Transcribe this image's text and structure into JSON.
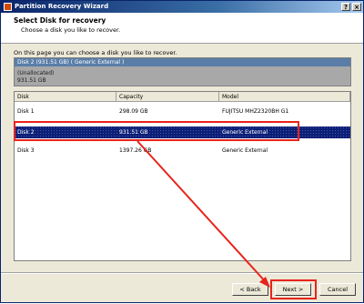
{
  "window": {
    "title": "Partition Recovery Wizard"
  },
  "titlebar_buttons": {
    "help": "?",
    "close": "×"
  },
  "header": {
    "title": "Select Disk for recovery",
    "subtitle": "Choose a disk you like to recover."
  },
  "intro_text": "On this page you can choose a disk you like to recover.",
  "disk_info": {
    "heading": "Disk 2 (931.51 GB) ( Generic External )",
    "line1": "(Unallocated)",
    "line2": "931.51 GB"
  },
  "table": {
    "columns": [
      "Disk",
      "Capacity",
      "Model"
    ],
    "rows": [
      {
        "disk": "Disk 1",
        "capacity": "298.09 GB",
        "model": "FUJITSU MHZ2320BH G1"
      },
      {
        "disk": "Disk 2",
        "capacity": "931.51 GB",
        "model": "Generic External"
      },
      {
        "disk": "Disk 3",
        "capacity": "1397.26 GB",
        "model": "Generic External"
      }
    ],
    "selected_index": 1
  },
  "buttons": {
    "back": "< Back",
    "next": "Next >",
    "cancel": "Cancel"
  },
  "colors": {
    "highlight": "#e8231b",
    "selection": "#0b1e78",
    "titlebar": "#0a246a"
  }
}
